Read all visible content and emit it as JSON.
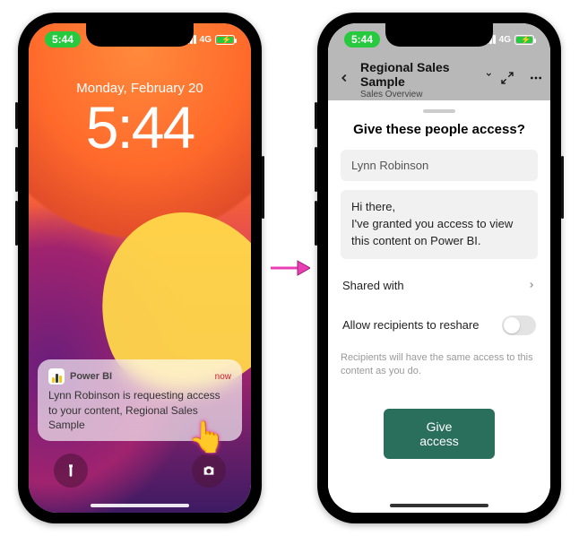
{
  "status": {
    "time": "5:44",
    "network": "4G"
  },
  "lockscreen": {
    "date": "Monday, February 20",
    "time": "5:44",
    "notification": {
      "app_name": "Power BI",
      "timestamp": "now",
      "body": "Lynn Robinson is requesting access to your content, Regional Sales Sample"
    }
  },
  "app": {
    "header": {
      "title": "Regional Sales Sample",
      "subtitle": "Sales Overview"
    },
    "sheet": {
      "title": "Give these people access?",
      "recipient": "Lynn Robinson",
      "message": "Hi there,\nI've granted you access to view this content on Power BI.",
      "shared_with_label": "Shared with",
      "reshare_label": "Allow recipients to reshare",
      "hint": "Recipients will have the same access to this content as you do.",
      "cta": "Give access"
    }
  }
}
